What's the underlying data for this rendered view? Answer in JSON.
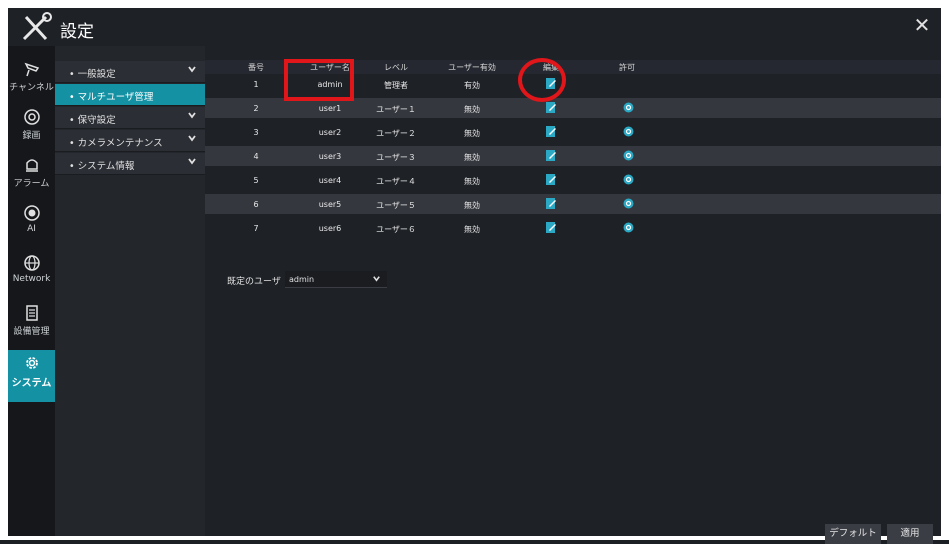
{
  "header": {
    "title": "設定"
  },
  "iconcol": [
    {
      "label": "チャンネル",
      "icon": "camera-icon"
    },
    {
      "label": "録画",
      "icon": "record-icon"
    },
    {
      "label": "アラーム",
      "icon": "bell-icon"
    },
    {
      "label": "AI",
      "icon": "ai-icon"
    },
    {
      "label": "Network",
      "icon": "globe-icon"
    },
    {
      "label": "設備管理",
      "icon": "device-icon"
    },
    {
      "label": "システム",
      "icon": "gear-icon"
    }
  ],
  "submenu": [
    {
      "label": "• 一般設定"
    },
    {
      "label": "• マルチユーザ管理"
    },
    {
      "label": "• 保守設定"
    },
    {
      "label": "• カメラメンテナンス"
    },
    {
      "label": "• システム情報"
    }
  ],
  "table": {
    "headers": [
      "番号",
      "ユーザー名",
      "レベル",
      "ユーザー有効",
      "編集",
      "許可"
    ],
    "rows": [
      {
        "num": "1",
        "user": "admin",
        "level": "管理者",
        "enabled": "有効"
      },
      {
        "num": "2",
        "user": "user1",
        "level": "ユーザー１",
        "enabled": "無効"
      },
      {
        "num": "3",
        "user": "user2",
        "level": "ユーザー２",
        "enabled": "無効"
      },
      {
        "num": "4",
        "user": "user3",
        "level": "ユーザー３",
        "enabled": "無効"
      },
      {
        "num": "5",
        "user": "user4",
        "level": "ユーザー４",
        "enabled": "無効"
      },
      {
        "num": "6",
        "user": "user5",
        "level": "ユーザー５",
        "enabled": "無効"
      },
      {
        "num": "7",
        "user": "user6",
        "level": "ユーザー６",
        "enabled": "無効"
      }
    ]
  },
  "fixed_user": {
    "label": "既定のユーザ",
    "value": "admin"
  },
  "buttons": {
    "default": "デフォルト",
    "apply": "適用"
  },
  "colors": {
    "accent": "#1591a4",
    "highlight": "#e0161a"
  }
}
